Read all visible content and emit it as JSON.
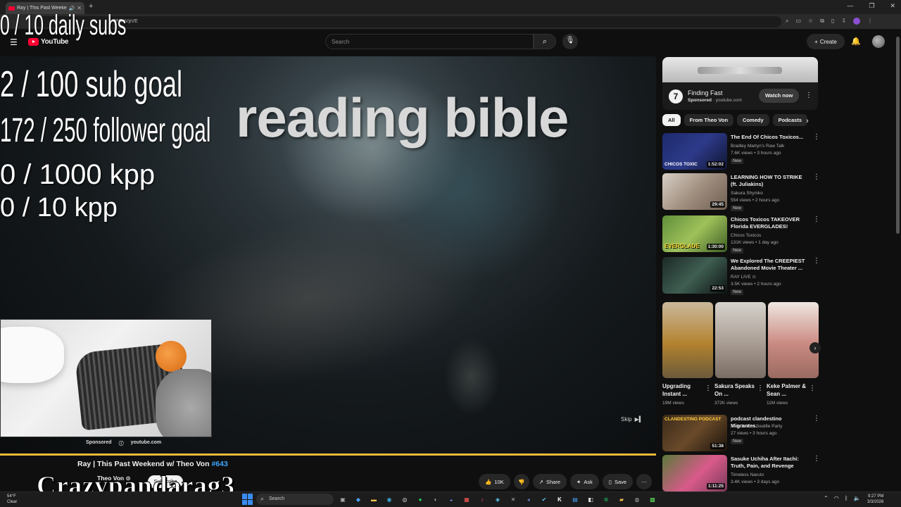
{
  "browser": {
    "tab_title": "Ray | This Past Weekend",
    "url_fragment": "4POuVpVE",
    "new_tab_label": "+",
    "window_controls": [
      "—",
      "❐",
      "✕"
    ]
  },
  "youtube": {
    "logo_text": "YouTube",
    "search_placeholder": "Search",
    "create_label": "Create"
  },
  "overlay": {
    "daily_subs": "0 / 10 daily subs",
    "sub_goal": "2  / 100 sub goal",
    "follower_goal": "172 / 250 follower goal",
    "kpp_1000": "0 / 1000 kpp",
    "kpp_10": "0 / 10 kpp",
    "streamer_name": "Crazypandarag3"
  },
  "player": {
    "caption": "reading bible",
    "skip_label": "Skip",
    "ad_sponsored": "Sponsored",
    "ad_domain": "youtube.com"
  },
  "video": {
    "title": "Ray | This Past Weekend w/ Theo Von",
    "episode": "#643",
    "channel": "Theo Von",
    "subscribe_label": "Subscribe",
    "likes": "10K",
    "share_label": "Share",
    "ask_label": "Ask",
    "save_label": "Save"
  },
  "sidebar": {
    "ad": {
      "title": "Finding Fast",
      "sponsored": "Sponsored",
      "domain": "youtube.com",
      "cta": "Watch now"
    },
    "chips": [
      "All",
      "From Theo Von",
      "Comedy",
      "Podcasts"
    ],
    "recs": [
      {
        "title": "The End Of Chicos Toxicos...",
        "channel": "Bradley Martyn's Raw Talk",
        "meta": "7.6K views • 3 hours ago",
        "badge": "New",
        "duration": "1:52:02",
        "thumb_text": "CHICOS TOXIC"
      },
      {
        "title": "LEARNING HOW TO STRIKE (ft. Juliakins)",
        "channel": "Sakura Shymko",
        "meta": "554 views • 2 hours ago",
        "badge": "New",
        "duration": "29:45"
      },
      {
        "title": "Chicos Toxicos TAKEOVER Florida EVERGLADES! (GATOR...",
        "channel": "Chicos Toxicos",
        "meta": "131K views • 1 day ago",
        "badge": "New",
        "duration": "1:30:00",
        "thumb_text": "EVERGLADE"
      },
      {
        "title": "We Explored The CREEPIEST Abandoned Movie Theater ...",
        "channel": "RAY LIVE",
        "meta": "3.5K views • 2 hours ago",
        "badge": "New",
        "duration": "22:53"
      }
    ],
    "shorts": [
      {
        "title": "Upgrading Instant ...",
        "views": "19M views"
      },
      {
        "title": "Sakura Speaks On ...",
        "views": "372K views"
      },
      {
        "title": "Keke Palmer & Sean ...",
        "views": "11M views"
      }
    ],
    "recs2": [
      {
        "title": "podcast clandestino Migrantes.",
        "channel": "Clandestino Seattle Party",
        "meta": "27 views • 3 hours ago",
        "badge": "New",
        "duration": "51:38",
        "thumb_text": "CLANDESTINO PODCAST"
      },
      {
        "title": "Sasuke Uchiha After Itachi: Truth, Pain, and Revenge",
        "channel": "Timeless Naruto",
        "meta": "3.4K views • 3 days ago",
        "duration": "1:11:25"
      }
    ]
  },
  "taskbar": {
    "temp": "54°F",
    "weather": "Clear",
    "search_label": "Search",
    "time": "9:27 PM",
    "date": "3/3/2026"
  },
  "colors": {
    "youtube_red": "#ff0033",
    "progress_bar": "#e8b93a",
    "link_blue": "#3ea6ff",
    "background": "#0f0f0f"
  }
}
